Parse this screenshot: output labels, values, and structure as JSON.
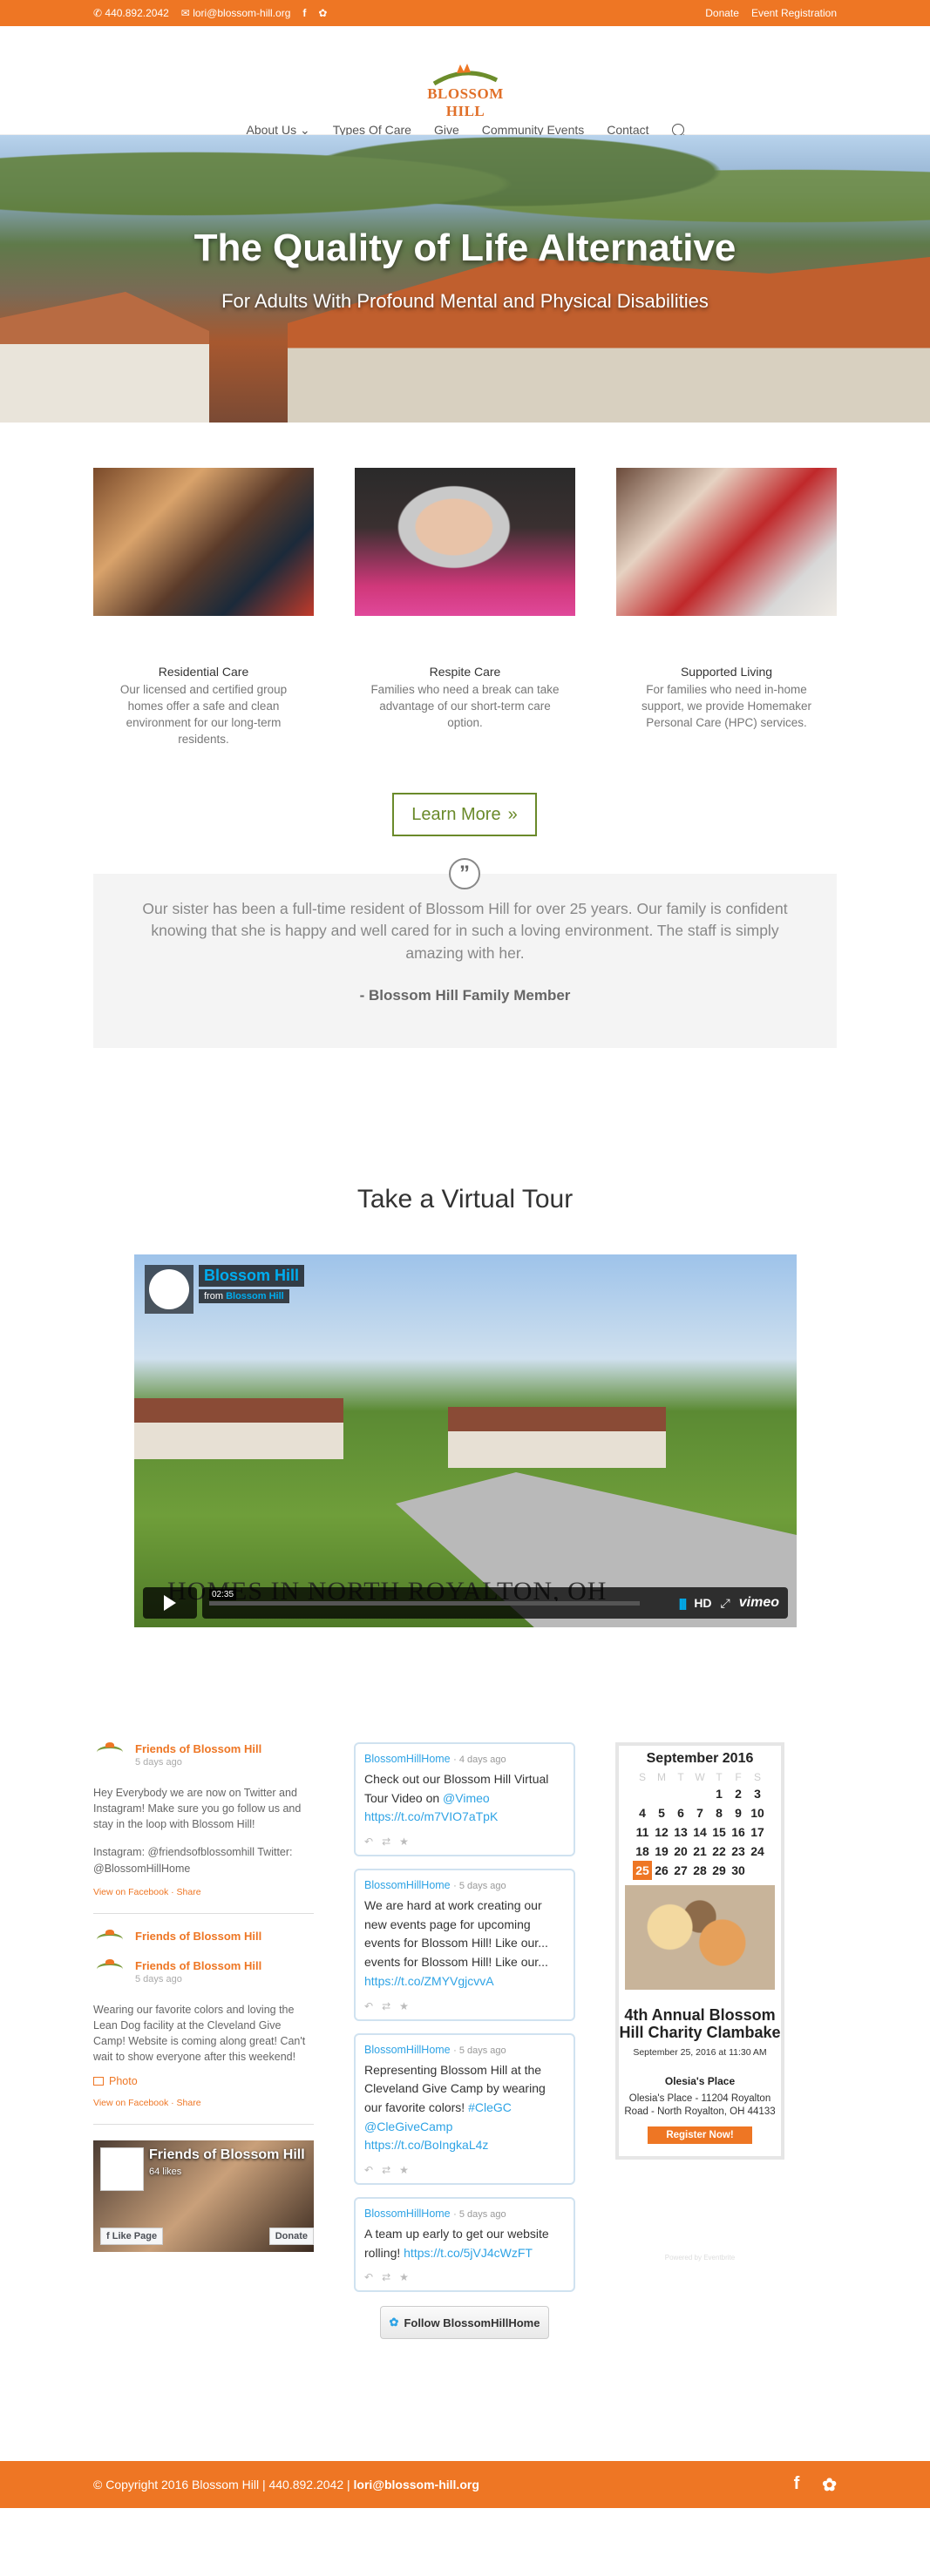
{
  "topbar": {
    "phone": "440.892.2042",
    "email": "lori@blossom-hill.org",
    "facebook_icon": "f",
    "twitter_icon": "t",
    "donate": "Donate",
    "event_registration": "Event Registration"
  },
  "header": {
    "logo_text": "BLOSSOM HILL",
    "nav": [
      {
        "label": "About Us"
      },
      {
        "label": "Types Of Care"
      },
      {
        "label": "Give"
      },
      {
        "label": "Community Events"
      },
      {
        "label": "Contact"
      }
    ]
  },
  "hero": {
    "title": "The Quality of Life Alternative",
    "subtitle": "For Adults With Profound Mental and Physical Disabilities"
  },
  "care": [
    {
      "title": "Residential Care",
      "text": "Our licensed and certified group homes offer a safe and clean environment for our long-term residents."
    },
    {
      "title": "Respite Care",
      "text": "Families who need a break can take advantage of our short-term care option."
    },
    {
      "title": "Supported Living",
      "text": "For families who need in-home support, we provide Homemaker Personal Care (HPC) services."
    }
  ],
  "learn_more": "Learn More",
  "testimonial": {
    "quote": "Our sister has been a full-time resident of Blossom Hill for over 25 years. Our family is confident knowing that she is happy and well cared for in such a loving environment. The staff is simply amazing with her.",
    "author": "- Blossom Hill Family Member"
  },
  "tour": {
    "title": "Take a Virtual Tour",
    "video_title": "Blossom Hill",
    "video_from": "from",
    "video_from_name": "Blossom Hill",
    "caption": "HOMES IN NORTH ROYALTON, OH",
    "duration": "02:35",
    "hd": "HD",
    "vimeo": "vimeo"
  },
  "facebook": {
    "posts": [
      {
        "name": "Friends of Blossom Hill",
        "ago": "5 days ago",
        "body": "Hey Everybody we are now on Twitter and Instagram! Make sure you go follow us and stay in the loop with Blossom Hill!",
        "body2": "Instagram: @friendsofblossomhill Twitter: @BlossomHillHome",
        "links": "View on Facebook · Share"
      },
      {
        "name": "Friends of Blossom Hill",
        "name2": "Friends of Blossom Hill",
        "ago": "5 days ago",
        "body": "Wearing our favorite colors and loving the Lean Dog facility at the Cleveland Give Camp! Website is coming along great! Can't wait to show everyone after this weekend!",
        "photo": "Photo",
        "links": "View on Facebook · Share"
      }
    ],
    "page": {
      "name": "Friends of Blossom Hill",
      "likes": "64 likes",
      "like_btn": "Like Page",
      "donate_btn": "Donate"
    }
  },
  "tweets": [
    {
      "handle": "BlossomHillHome",
      "ago": "· 4 days ago",
      "pre": "Check out our Blossom Hill Virtual Tour Video on ",
      "mention": "@Vimeo",
      "link": "https://t.co/m7VIO7aTpK"
    },
    {
      "handle": "BlossomHillHome",
      "ago": "· 5 days ago",
      "pre": "We are hard at work creating our new events page for upcoming events for Blossom Hill! Like our... events for Blossom Hill! Like our... ",
      "mention": "",
      "link": "https://t.co/ZMYVgjcvvA"
    },
    {
      "handle": "BlossomHillHome",
      "ago": "· 5 days ago",
      "pre": "Representing Blossom Hill at the Cleveland Give Camp by wearing our favorite colors! ",
      "mention": "#CleGC @CleGiveCamp",
      "link": "https://t.co/BoIngkaL4z"
    },
    {
      "handle": "BlossomHillHome",
      "ago": "· 5 days ago",
      "pre": "A team up early to get our website rolling! ",
      "mention": "",
      "link": "https://t.co/5jVJ4cWzFT"
    }
  ],
  "follow": "Follow BlossomHillHome",
  "calendar": {
    "month": "September 2016",
    "dow": [
      "S",
      "M",
      "T",
      "W",
      "T",
      "F",
      "S"
    ],
    "weeks": [
      [
        "",
        "",
        "",
        "",
        "1",
        "2",
        "3"
      ],
      [
        "4",
        "5",
        "6",
        "7",
        "8",
        "9",
        "10"
      ],
      [
        "11",
        "12",
        "13",
        "14",
        "15",
        "16",
        "17"
      ],
      [
        "18",
        "19",
        "20",
        "21",
        "22",
        "23",
        "24"
      ],
      [
        "25",
        "26",
        "27",
        "28",
        "29",
        "30",
        ""
      ]
    ],
    "today": "25",
    "event_title": "4th Annual Blossom Hill Charity Clambake",
    "event_date": "September 25, 2016 at 11:30 AM",
    "venue": "Olesia's Place",
    "address": "Olesia's Place - 11204 Royalton Road - North Royalton, OH 44133",
    "register": "Register Now!",
    "powered": "Powered by Eventbrite"
  },
  "footer": {
    "copyright": "© Copyright 2016 Blossom Hill | 440.892.2042 | ",
    "email": "lori@blossom-hill.org",
    "facebook_icon": "f",
    "twitter_icon": "t"
  },
  "colors": {
    "accent": "#ee7624",
    "green": "#6a8a2a",
    "twitter_blue": "#2ea3e5"
  }
}
